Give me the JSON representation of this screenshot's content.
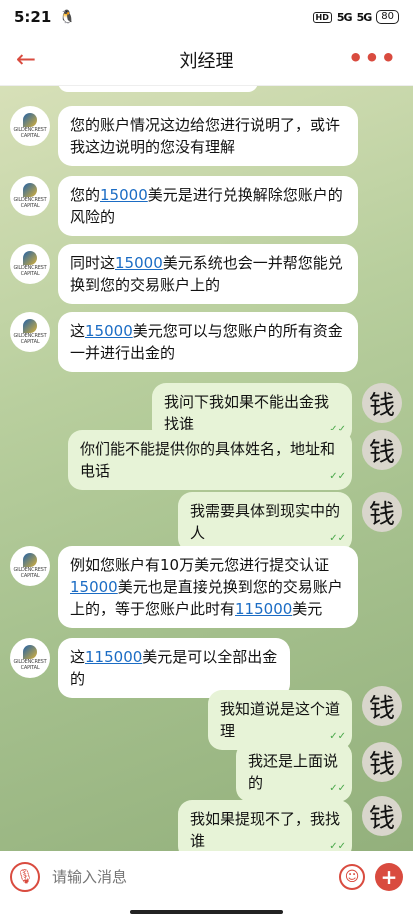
{
  "status_bar": {
    "time": "5:21",
    "qq_icon": "qq-icon",
    "hd": "HD",
    "signal1": "5G",
    "signal2": "5G",
    "battery": "80"
  },
  "header": {
    "title": "刘经理",
    "back_icon": "back-arrow-icon",
    "more_icon": "more-icon"
  },
  "avatars": {
    "left_brand": "GILDENCREST CAPITAL",
    "right_glyph": "钱"
  },
  "messages": [
    {
      "side": "in",
      "parts": [
        {
          "t": "您的账户情况这边给您进行说明了，或许我这边说明的您没有理解"
        }
      ]
    },
    {
      "side": "in",
      "parts": [
        {
          "t": "您的"
        },
        {
          "t": "15000",
          "hl": true
        },
        {
          "t": "美元是进行兑换解除您账户的风险的"
        }
      ]
    },
    {
      "side": "in",
      "parts": [
        {
          "t": "同时这"
        },
        {
          "t": "15000",
          "hl": true
        },
        {
          "t": "美元系统也会一并帮您能兑换到您的交易账户上的"
        }
      ]
    },
    {
      "side": "in",
      "parts": [
        {
          "t": "这"
        },
        {
          "t": "15000",
          "hl": true
        },
        {
          "t": "美元您可以与您账户的所有资金一并进行出金的"
        }
      ]
    },
    {
      "side": "out",
      "parts": [
        {
          "t": "我问下我如果不能出金我找谁"
        }
      ]
    },
    {
      "side": "out",
      "parts": [
        {
          "t": "你们能不能提供你的具体姓名，地址和电话"
        }
      ]
    },
    {
      "side": "out",
      "parts": [
        {
          "t": "我需要具体到现实中的人"
        }
      ]
    },
    {
      "side": "in",
      "parts": [
        {
          "t": "例如您账户有10万美元您进行提交认证"
        },
        {
          "t": "15000",
          "hl": true
        },
        {
          "t": "美元也是直接兑换到您的交易账户上的，等于您账户此时有"
        },
        {
          "t": "115000",
          "hl": true
        },
        {
          "t": "美元"
        }
      ]
    },
    {
      "side": "in",
      "parts": [
        {
          "t": "这"
        },
        {
          "t": "115000",
          "hl": true
        },
        {
          "t": "美元是可以全部出金的"
        }
      ]
    },
    {
      "side": "out",
      "parts": [
        {
          "t": "我知道说是这个道理"
        }
      ]
    },
    {
      "side": "out",
      "parts": [
        {
          "t": "我还是上面说的"
        }
      ]
    },
    {
      "side": "out",
      "parts": [
        {
          "t": "我如果提现不了，我找谁"
        }
      ]
    }
  ],
  "input": {
    "placeholder": "请输入消息"
  },
  "colors": {
    "accent": "#d94b3f",
    "link": "#1b6cc4",
    "outgoing": "#e7f3d7"
  }
}
